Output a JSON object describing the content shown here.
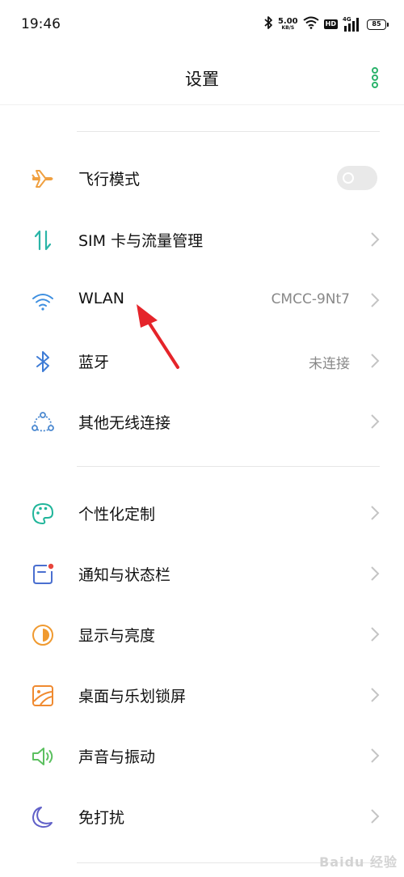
{
  "status_bar": {
    "time": "19:46",
    "net_speed": "5.00",
    "net_speed_unit": "KB/S",
    "hd": "HD",
    "network_type": "4G",
    "battery": "85"
  },
  "header": {
    "title": "设置"
  },
  "settings": [
    {
      "label": "飞行模式",
      "icon": "airplane-icon",
      "toggle": "off"
    },
    {
      "label": "SIM 卡与流量管理",
      "icon": "sim-data-icon"
    },
    {
      "label": "WLAN",
      "value": "CMCC-9Nt7",
      "icon": "wifi-icon"
    },
    {
      "label": "蓝牙",
      "value": "未连接",
      "icon": "bluetooth-icon"
    },
    {
      "label": "其他无线连接",
      "icon": "wireless-connections-icon"
    },
    {
      "label": "个性化定制",
      "icon": "palette-icon"
    },
    {
      "label": "通知与状态栏",
      "icon": "notification-icon"
    },
    {
      "label": "显示与亮度",
      "icon": "display-brightness-icon"
    },
    {
      "label": "桌面与乐划锁屏",
      "icon": "wallpaper-icon"
    },
    {
      "label": "声音与振动",
      "icon": "sound-icon"
    },
    {
      "label": "免打扰",
      "icon": "moon-icon"
    }
  ],
  "annotation": {
    "pointer": "red-arrow"
  },
  "watermark": "Baidu 经验",
  "colors": {
    "airplane": "#F0A040",
    "sim": "#2BB5A8",
    "wifi": "#3E8FE0",
    "bluetooth": "#3E7CD6",
    "connections": "#4A88D0",
    "palette": "#20B59A",
    "notification": "#4A6FD0",
    "display": "#F09A30",
    "wallpaper": "#F08A30",
    "sound": "#5CC060",
    "moon": "#6060C8",
    "accent": "#2BB36B",
    "arrow": "#E5242A"
  }
}
